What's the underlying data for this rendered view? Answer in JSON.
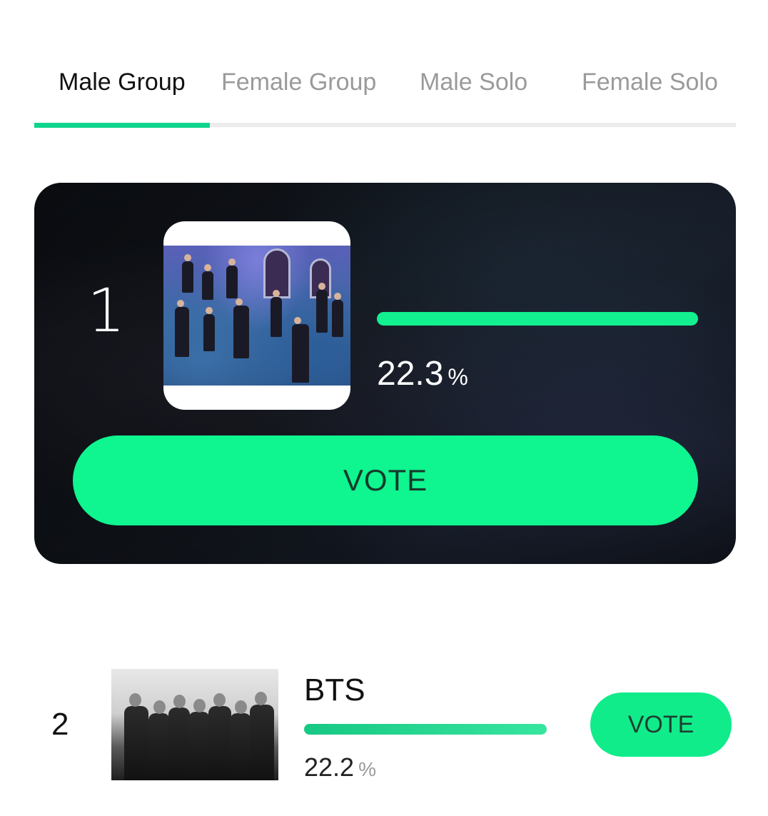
{
  "tabs": [
    {
      "label": "Male Group",
      "active": true
    },
    {
      "label": "Female Group",
      "active": false
    },
    {
      "label": "Male Solo",
      "active": false
    },
    {
      "label": "Female Solo",
      "active": false
    }
  ],
  "colors": {
    "accent": "#0fd58c",
    "vote_button": "#0ff58f",
    "tab_inactive": "#9a9a9a"
  },
  "ranking": [
    {
      "rank": "1",
      "name": "",
      "percent": "22.3",
      "percent_value": 22.3,
      "unit": "%",
      "vote_label": "VOTE",
      "photo_icon": "group-photo"
    },
    {
      "rank": "2",
      "name": "BTS",
      "percent": "22.2",
      "percent_value": 22.2,
      "unit": "%",
      "vote_label": "VOTE",
      "photo_icon": "group-photo-bw"
    }
  ]
}
